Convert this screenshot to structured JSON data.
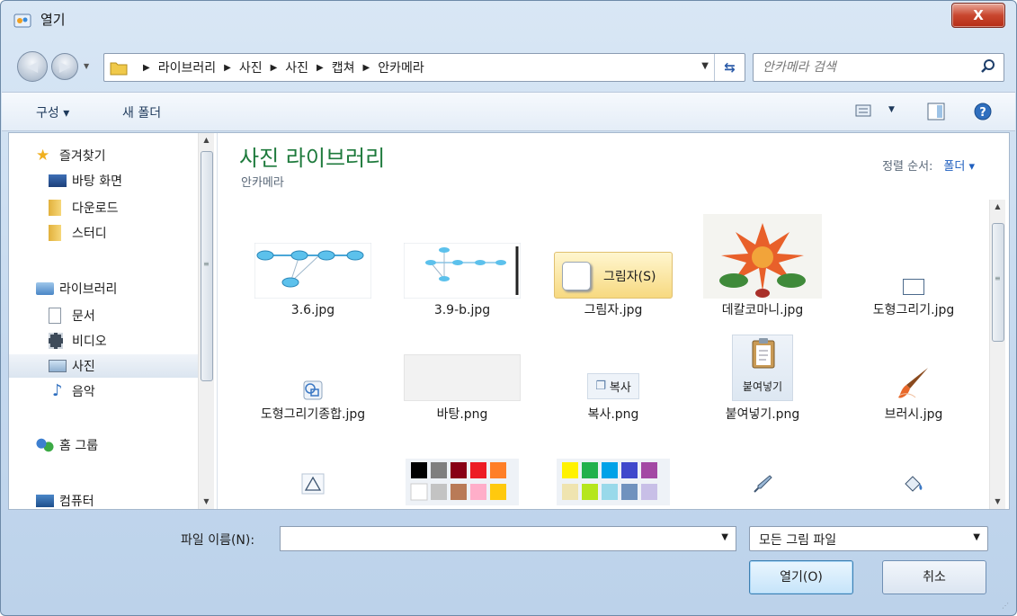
{
  "window": {
    "title": "열기",
    "close_label": "X"
  },
  "address": {
    "crumbs": [
      "라이브러리",
      "사진",
      "사진",
      "캡쳐",
      "안카메라"
    ]
  },
  "search": {
    "placeholder": "안카메라 검색"
  },
  "toolbar": {
    "organize_label": "구성 ▾",
    "new_folder_label": "새 폴더"
  },
  "nav": {
    "favorites": "즐겨찾기",
    "desktop": "바탕 화면",
    "downloads": "다운로드",
    "study": "스터디",
    "libraries": "라이브러리",
    "documents": "문서",
    "videos": "비디오",
    "pictures": "사진",
    "music": "음악",
    "homegroup": "홈 그룹",
    "computer": "컴퓨터"
  },
  "library": {
    "title": "사진 라이브러리",
    "subtitle": "안카메라",
    "sort_label": "정렬 순서:",
    "sort_value": "폴더 ▾"
  },
  "files": [
    {
      "name": "3.6.jpg"
    },
    {
      "name": "3.9-b.jpg"
    },
    {
      "name": "그림자.jpg",
      "thumb_text": "그림자(S)"
    },
    {
      "name": "데칼코마니.jpg"
    },
    {
      "name": "도형그리기.jpg"
    },
    {
      "name": "도형그리기종합.jpg"
    },
    {
      "name": "바탕.png"
    },
    {
      "name": "복사.png",
      "thumb_text": "복사"
    },
    {
      "name": "붙여넣기.png",
      "thumb_text": "붙여넣기"
    },
    {
      "name": "브러시.jpg"
    }
  ],
  "filename": {
    "label": "파일 이름(N):",
    "value": ""
  },
  "filter": {
    "value": "모든 그림 파일"
  },
  "buttons": {
    "open": "열기(O)",
    "cancel": "취소"
  },
  "colors": {
    "accent_title": "#1e7a3c",
    "link": "#1f5fbf",
    "close_red": "#c9472f"
  }
}
